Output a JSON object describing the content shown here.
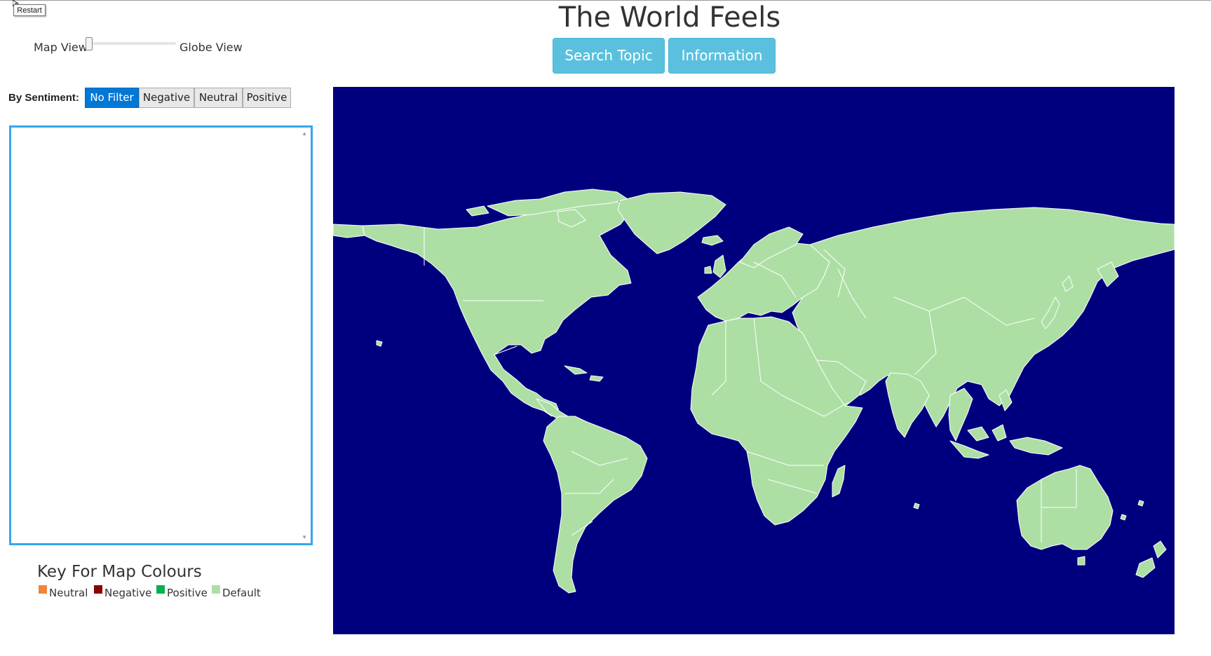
{
  "app": {
    "title": "The World Feels",
    "restart_label": "Restart"
  },
  "header": {
    "search_topic_label": "Search Topic",
    "information_label": "Information"
  },
  "view_toggle": {
    "left_label": "Map View",
    "right_label": "Globe View",
    "value": 0
  },
  "sentiment_filter": {
    "label": "By Sentiment:",
    "options": [
      "No Filter",
      "Negative",
      "Neutral",
      "Positive"
    ],
    "selected": "No Filter"
  },
  "tweet_list": {
    "items": []
  },
  "key": {
    "title": "Key For Map Colours",
    "items": [
      {
        "label": "Neutral",
        "color": "#f0843c"
      },
      {
        "label": "Negative",
        "color": "#8b0000"
      },
      {
        "label": "Positive",
        "color": "#00b050"
      },
      {
        "label": "Default",
        "color": "#addfa5"
      }
    ]
  },
  "map": {
    "ocean_color": "#00007f",
    "land_color": "#addfa5",
    "border_color": "#ffffff"
  }
}
